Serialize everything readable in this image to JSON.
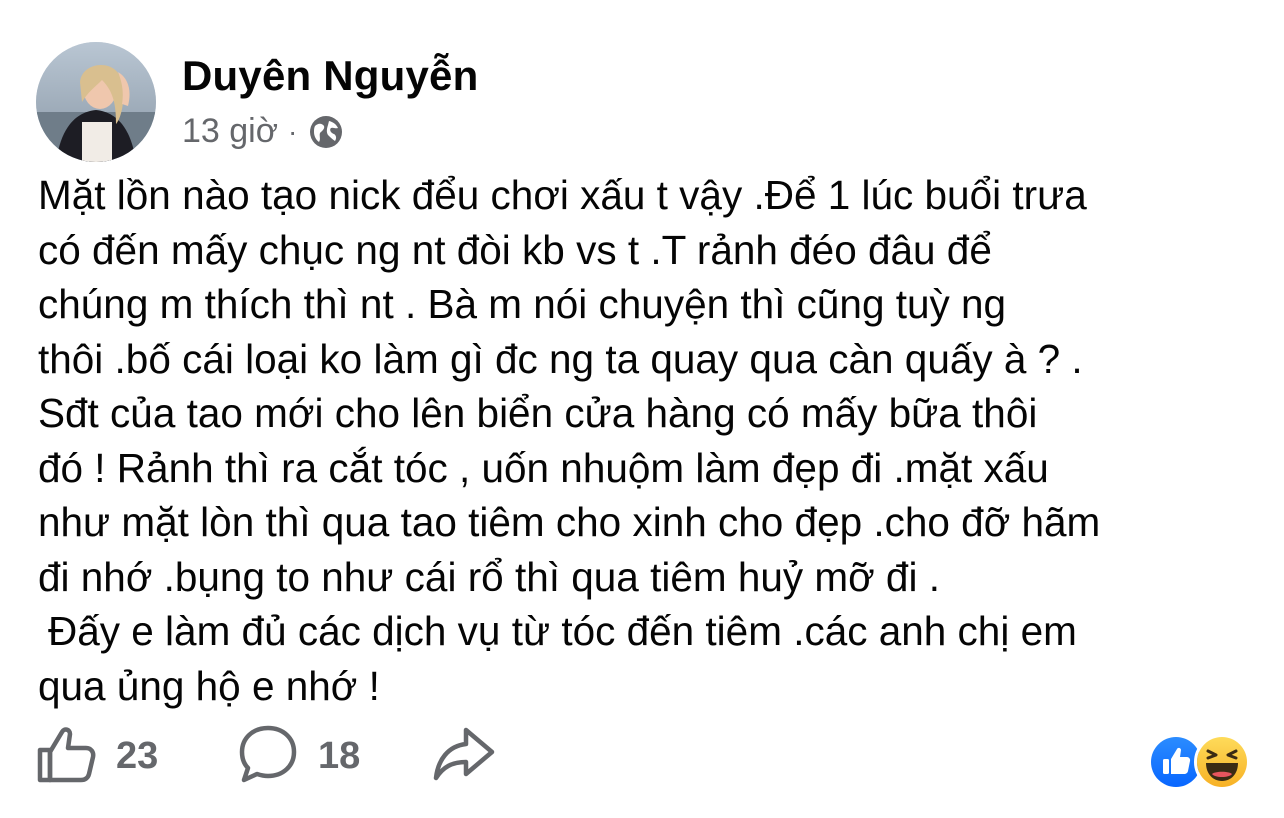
{
  "post": {
    "author": "Duyên Nguyễn",
    "time": "13 giờ",
    "separator": "·",
    "privacy_icon": "globe-icon",
    "lines": [
      "Mặt lồn nào tạo nick đểu chơi xấu t vậy .Để 1 lúc buổi trưa",
      "có đến mấy chục ng nt đòi kb vs t .T rảnh đéo đâu để",
      "chúng m thích thì nt . Bà m nói chuyện thì cũng tuỳ ng",
      "thôi .bố cái loại ko làm gì đc ng ta quay qua càn quấy à ? .",
      "Sđt của tao mới cho lên biển cửa hàng có mấy bữa thôi",
      "đó ! Rảnh thì ra cắt tóc , uốn nhuộm làm đẹp đi .mặt xấu",
      "như mặt lòn thì qua tao tiêm cho xinh cho đẹp .cho đỡ hãm",
      "đi nhớ .bụng to như cái rổ thì qua tiêm huỷ mỡ đi .",
      "Đấy e làm đủ các dịch vụ từ tóc đến tiêm .các anh chị em",
      "qua ủng hộ e nhớ !"
    ]
  },
  "actions": {
    "like_icon": "thumbs-up-icon",
    "like_count": "23",
    "comment_icon": "comment-bubble-icon",
    "comment_count": "18",
    "share_icon": "share-arrow-icon"
  },
  "reactions": [
    "like-reaction-icon",
    "haha-reaction-icon"
  ],
  "colors": {
    "text": "#050505",
    "secondary": "#65676b",
    "like_blue": "#1877f2",
    "haha_yellow": "#f7b125"
  }
}
